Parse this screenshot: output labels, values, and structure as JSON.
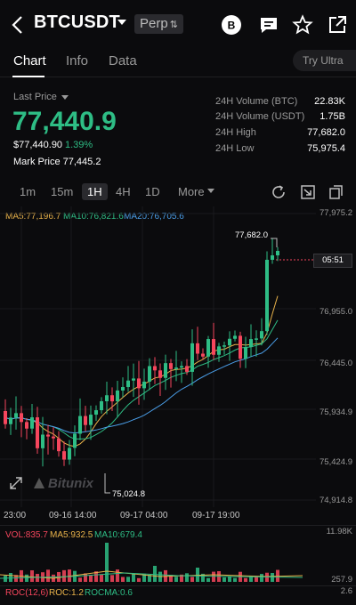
{
  "header": {
    "symbol": "BTCUSDT",
    "perp_label": "Perp",
    "icons": [
      "back-arrow-icon",
      "bitunix-coin-icon",
      "chat-icon",
      "star-icon",
      "share-icon"
    ]
  },
  "tabs": [
    {
      "label": "Chart",
      "active": true
    },
    {
      "label": "Info",
      "active": false
    },
    {
      "label": "Data",
      "active": false
    }
  ],
  "try_ultra": "Try Ultra",
  "ticker": {
    "last_price_label": "Last Price",
    "last_price": "77,440.9",
    "usd_value": "$77,440.90",
    "change_pct": "1.39%",
    "mark_price": "Mark Price  77,445.2",
    "up_color": "#2ebd85",
    "down_color": "#f6465d"
  },
  "stats": [
    {
      "label": "24H Volume (BTC)",
      "value": "22.83K"
    },
    {
      "label": "24H Volume (USDT)",
      "value": "1.75B"
    },
    {
      "label": "24H High",
      "value": "77,682.0"
    },
    {
      "label": "24H Low",
      "value": "75,975.4"
    }
  ],
  "intervals": [
    {
      "label": "1m",
      "active": false
    },
    {
      "label": "15m",
      "active": false
    },
    {
      "label": "1H",
      "active": true
    },
    {
      "label": "4H",
      "active": false
    },
    {
      "label": "1D",
      "active": false
    },
    {
      "label": "More",
      "active": false
    }
  ],
  "toolbar_icons": [
    "refresh-icon",
    "indicator-icon",
    "copy-icon"
  ],
  "ma_legend": [
    {
      "text": "MA5:77,196.7",
      "color": "#e8b24a"
    },
    {
      "text": "MA10:76,821.6",
      "color": "#2ebd85"
    },
    {
      "text": "MA20:76,705.6",
      "color": "#4a9ee8"
    }
  ],
  "y_axis": [
    "77,975.2",
    "76,955.0",
    "76,445.0",
    "75,934.9",
    "75,424.9",
    "74,914.8"
  ],
  "x_axis": [
    "23:00",
    "09-16 14:00",
    "09-17 04:00",
    "09-17 19:00"
  ],
  "annotations": {
    "high": "77,682.0",
    "low": "75,024.8",
    "countdown": "05:51"
  },
  "watermark": "Bitunix",
  "volume": {
    "vol": "VOL:835.7",
    "ma5": "MA5:932.5",
    "ma10": "MA10:679.4",
    "axis_top": "11.98K",
    "axis_bottom": "257.9"
  },
  "roc": {
    "roc_label": "ROC(12,6)",
    "roc": "ROC:1.2",
    "rocma": "ROCMA:0.6",
    "axis_top": "2.6"
  }
}
